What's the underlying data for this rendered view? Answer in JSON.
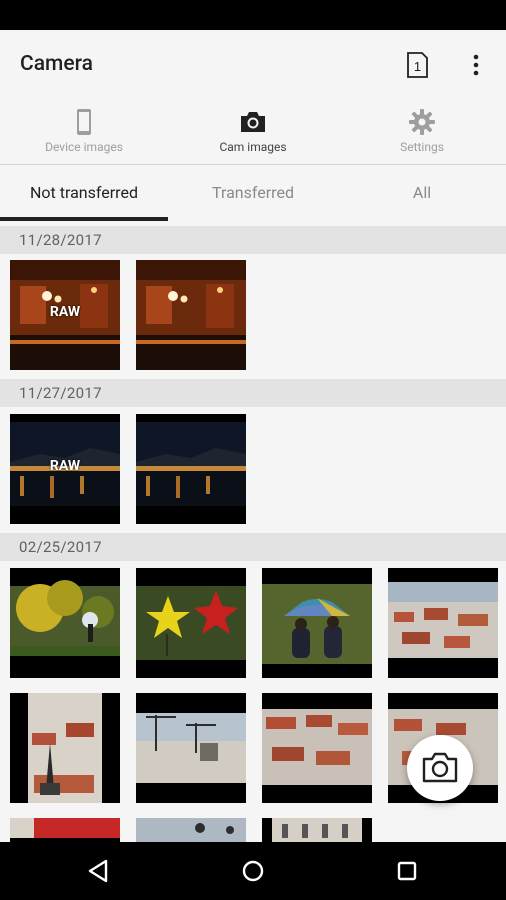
{
  "app": {
    "title": "Camera"
  },
  "topnav": {
    "items": [
      {
        "label": "Device images",
        "icon": "phone-icon"
      },
      {
        "label": "Cam images",
        "icon": "camera-icon"
      },
      {
        "label": "Settings",
        "icon": "gear-icon"
      }
    ],
    "active_index": 1
  },
  "tabs": {
    "items": [
      {
        "label": "Not transferred"
      },
      {
        "label": "Transferred"
      },
      {
        "label": "All"
      }
    ],
    "active_index": 0
  },
  "sections": [
    {
      "date": "11/28/2017",
      "thumbs": [
        {
          "raw_label": "RAW",
          "scene": "restaurant"
        },
        {
          "raw_label": "",
          "scene": "restaurant"
        }
      ]
    },
    {
      "date": "11/27/2017",
      "thumbs": [
        {
          "raw_label": "RAW",
          "scene": "night-city"
        },
        {
          "raw_label": "",
          "scene": "night-city"
        }
      ]
    },
    {
      "date": "02/25/2017",
      "thumbs": [
        {
          "scene": "autumn-park"
        },
        {
          "scene": "autumn-leaves"
        },
        {
          "scene": "umbrella-couple"
        },
        {
          "scene": "cityscape"
        },
        {
          "scene": "church-spire"
        },
        {
          "scene": "construction-cranes"
        },
        {
          "scene": "rooftops"
        },
        {
          "scene": "rooftops-2"
        },
        {
          "scene": "red-banner"
        },
        {
          "scene": "street-lamps"
        },
        {
          "scene": "balconies"
        }
      ]
    }
  ],
  "colors": {
    "accent": "#212121",
    "header_bg": "#e3e3e3",
    "inactive": "#9e9e9e"
  }
}
